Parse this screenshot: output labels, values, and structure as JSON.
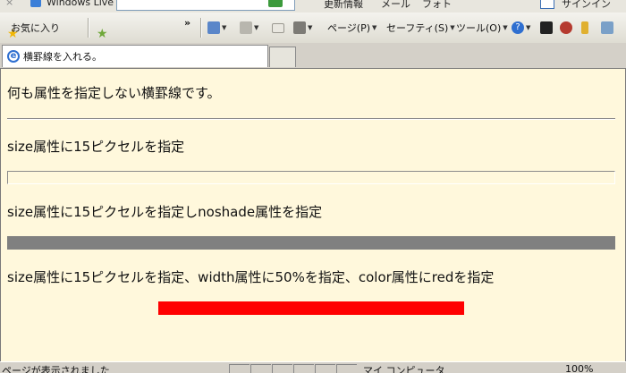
{
  "toolbar_top": {
    "windows_live_label": "Windows Live",
    "menu_update_info": "更新情報",
    "menu_mail": "メール",
    "menu_photo": "フォト",
    "menu_signin": "サインイン"
  },
  "command_bar": {
    "favorites_label": "お気に入り",
    "overflow": "»",
    "page_menu": "ページ(P)",
    "safety_menu": "セーフティ(S)",
    "tools_menu": "ツール(O)",
    "help_icon": "help-icon"
  },
  "tabs": [
    {
      "title": "横罫線を入れる。"
    }
  ],
  "content": {
    "line1": "何も属性を指定しない横罫線です。",
    "line2": "size属性に15ピクセルを指定",
    "line3": "size属性に15ピクセルを指定しnoshade属性を指定",
    "line4": "size属性に15ピクセルを指定、width属性に50%を指定、color属性にredを指定",
    "hr_red_color": "#ff0000",
    "hr_noshade_color": "#808080"
  },
  "status_bar": {
    "message": "ページが表示されました",
    "zone": "マイ コンピュータ",
    "zoom": "100%"
  }
}
